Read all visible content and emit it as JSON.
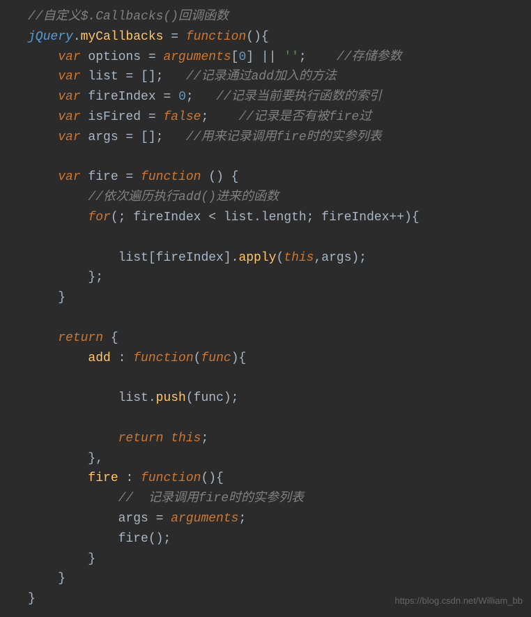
{
  "code": {
    "line1_comment": "//自定义$.Callbacks()回调函数",
    "line2_jquery": "jQuery",
    "line2_dot": ".",
    "line2_myCallbacks": "myCallbacks",
    "line2_equals": " = ",
    "line2_function": "function",
    "line2_parens": "(){",
    "line3_var": "var",
    "line3_options": " options = ",
    "line3_arguments": "arguments",
    "line3_bracket": "[",
    "line3_zero": "0",
    "line3_close": "] || ",
    "line3_empty": "''",
    "line3_semi": ";    ",
    "line3_comment": "//存储参数",
    "line4_var": "var",
    "line4_list": " list = [];   ",
    "line4_comment": "//记录通过add加入的方法",
    "line5_var": "var",
    "line5_fireIndex": " fireIndex = ",
    "line5_zero": "0",
    "line5_semi": ";   ",
    "line5_comment": "//记录当前要执行函数的索引",
    "line6_var": "var",
    "line6_isFired": " isFired = ",
    "line6_false": "false",
    "line6_semi": ";    ",
    "line6_comment": "//记录是否有被fire过",
    "line7_var": "var",
    "line7_args": " args = [];   ",
    "line7_comment": "//用来记录调用fire时的实参列表",
    "line9_var": "var",
    "line9_fire": " fire = ",
    "line9_function": "function",
    "line9_parens": " () {",
    "line10_comment": "//依次遍历执行add()进来的函数",
    "line11_for": "for",
    "line11_cond": "(; fireIndex < list.length; fireIndex++){",
    "line13_list": "list[fireIndex].",
    "line13_apply": "apply",
    "line13_open": "(",
    "line13_this": "this",
    "line13_close": ",args);",
    "line14_close": "};",
    "line15_close": "}",
    "line17_return": "return",
    "line17_brace": " {",
    "line18_add": "add",
    "line18_colon": " : ",
    "line18_function": "function",
    "line18_open": "(",
    "line18_func": "func",
    "line18_close": "){",
    "line20_list": "list.",
    "line20_push": "push",
    "line20_parens": "(func);",
    "line22_return": "return",
    "line22_space": " ",
    "line22_this": "this",
    "line22_semi": ";",
    "line23_close": "},",
    "line24_fire": "fire",
    "line24_colon": " : ",
    "line24_function": "function",
    "line24_parens": "(){",
    "line25_comment": "//  记录调用fire时的实参列表",
    "line26_args": "args = ",
    "line26_arguments": "arguments",
    "line26_semi": ";",
    "line27_fire": "fire();",
    "line28_close": "}",
    "line29_close": "}",
    "line30_close": "}"
  },
  "watermark": "https://blog.csdn.net/William_bb"
}
